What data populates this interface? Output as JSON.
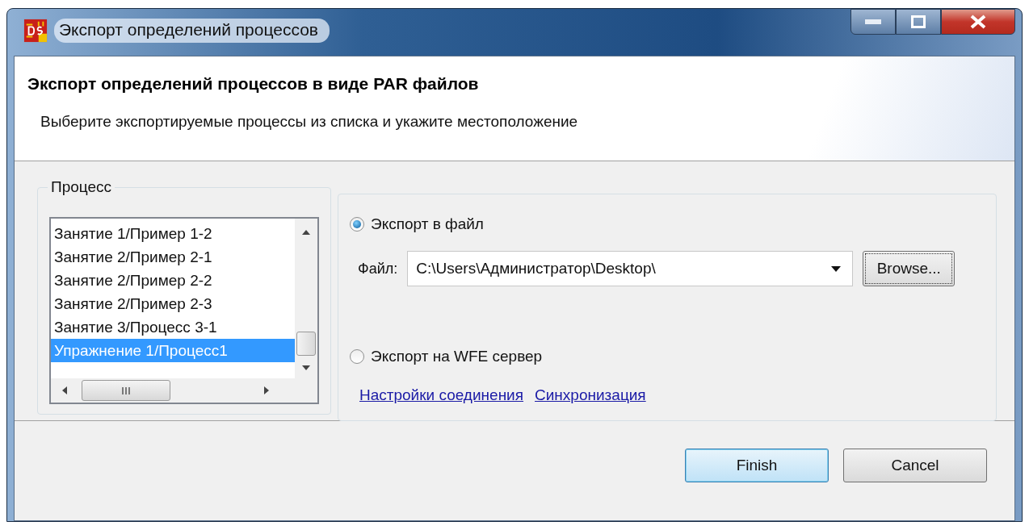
{
  "window": {
    "title": "Экспорт определений процессов"
  },
  "header": {
    "title": "Экспорт определений процессов в виде PAR файлов",
    "description": "Выберите экспортируемые процессы из списка и укажите местоположение"
  },
  "process_group": {
    "label": "Процесс",
    "items": [
      {
        "label": "Занятие 1/Пример 1-2",
        "selected": false
      },
      {
        "label": "Занятие 2/Пример 2-1",
        "selected": false
      },
      {
        "label": "Занятие 2/Пример 2-2",
        "selected": false
      },
      {
        "label": "Занятие 2/Пример 2-3",
        "selected": false
      },
      {
        "label": "Занятие 3/Процесс 3-1",
        "selected": false
      },
      {
        "label": "Упражнение 1/Процесс1",
        "selected": true
      }
    ]
  },
  "export": {
    "file_option": {
      "label": "Экспорт в файл",
      "selected": true
    },
    "file_label": "Файл:",
    "file_value": "C:\\Users\\Администратор\\Desktop\\",
    "browse": "Browse...",
    "server_option": {
      "label": "Экспорт на WFE сервер",
      "selected": false
    },
    "links": [
      "Настройки соединения",
      "Синхронизация"
    ]
  },
  "buttons": [
    {
      "label": "Finish",
      "kind": "default"
    },
    {
      "label": "Cancel",
      "kind": "normal"
    }
  ]
}
